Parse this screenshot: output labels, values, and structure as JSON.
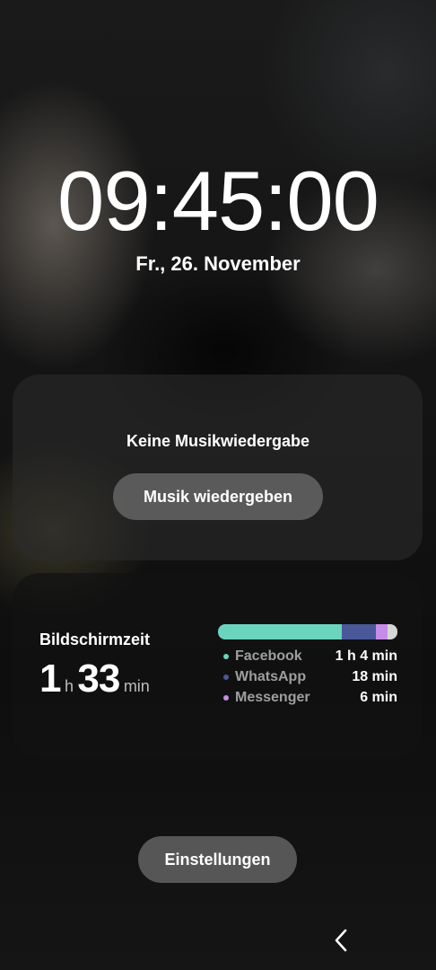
{
  "lockscreen": {
    "time": "09:45:00",
    "date": "Fr., 26. November"
  },
  "music": {
    "title": "Keine Musikwiedergabe",
    "play_button": "Musik wiedergeben"
  },
  "screen_time": {
    "label": "Bildschirmzeit",
    "hours": "1",
    "hours_unit": "h",
    "minutes": "33",
    "minutes_unit": "min",
    "apps": [
      {
        "name": "Facebook",
        "time": "1 h 4 min",
        "minutes": 64,
        "color": "#6bd4bd"
      },
      {
        "name": "WhatsApp",
        "time": "18 min",
        "minutes": 18,
        "color": "#4a5899"
      },
      {
        "name": "Messenger",
        "time": "6 min",
        "minutes": 6,
        "color": "#c68ce8"
      }
    ],
    "other_color": "#d6d6d6"
  },
  "settings_button": "Einstellungen",
  "nav": {
    "back_icon": "chevron-left-icon"
  }
}
